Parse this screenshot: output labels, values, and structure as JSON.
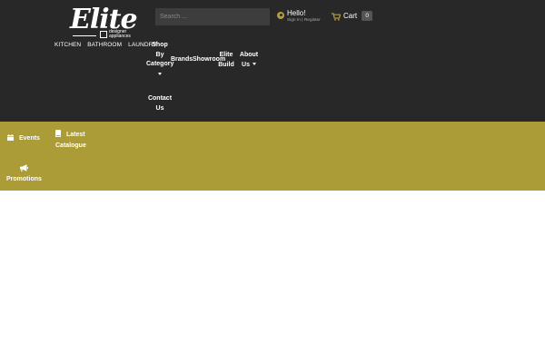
{
  "brand": {
    "logo_word": "Elite",
    "logo_sub": "designer appliances",
    "categories": [
      "KITCHEN",
      "BATHROOM",
      "LAUNDRY"
    ]
  },
  "search": {
    "placeholder": "Search ..."
  },
  "account": {
    "greeting": "Hello!",
    "signin": "Sign In | Register"
  },
  "cart": {
    "label": "Cart",
    "count": "0"
  },
  "nav": {
    "shop_line1": "Shop",
    "shop_line2": "By",
    "shop_line3": "Category",
    "brands": "Brands",
    "showroom": "Showroom",
    "elite_line1": "Elite",
    "elite_line2": "Build",
    "about_line1": "About",
    "about_line2": "Us",
    "contact_line1": "Contact",
    "contact_line2": "Us"
  },
  "subnav": {
    "events": "Events",
    "catalogue_line1": "Latest",
    "catalogue_line2": "Catalogue",
    "promotions": "Promotions"
  },
  "colors": {
    "header_bg": "#282828",
    "accent_gold": "#ab9c38",
    "icon_gold": "#b39c3a"
  },
  "icons": [
    "user-icon",
    "cart-icon",
    "calendar-icon",
    "book-icon",
    "megaphone-icon",
    "caret-down-icon"
  ]
}
